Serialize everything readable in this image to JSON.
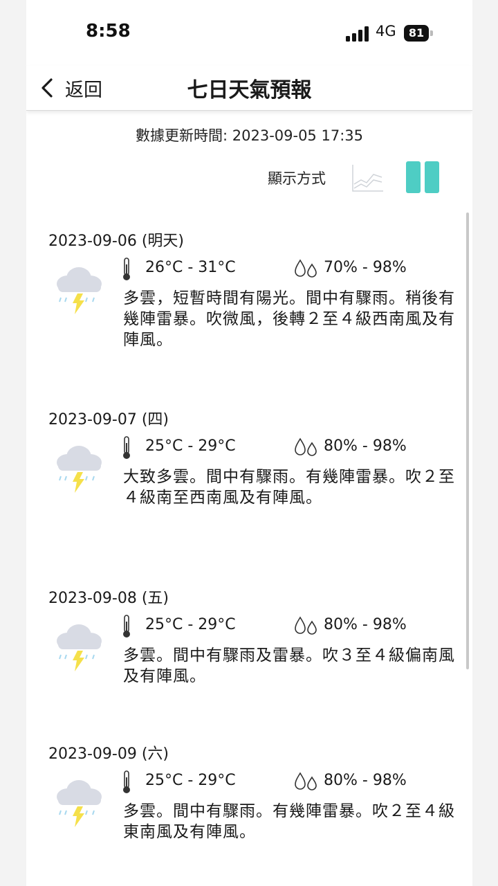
{
  "status": {
    "time": "8:58",
    "network": "4G",
    "battery": "81"
  },
  "nav": {
    "back_label": "返回",
    "title": "七日天氣預報"
  },
  "update_time": "數據更新時間: 2023-09-05 17:35",
  "display_mode": {
    "label": "顯示方式",
    "selected": "bar"
  },
  "colors": {
    "accent": "#4ecdc4",
    "cloud": "#d8dbe4",
    "rain": "#a8d8ef",
    "lightning": "#f5e04a"
  },
  "forecast": [
    {
      "date": "2023-09-06 (明天)",
      "icon": "cloud-thunder-rain-icon",
      "temp": "26°C - 31°C",
      "humidity": "70% - 98%",
      "desc": "多雲，短暫時間有陽光。間中有驟雨。稍後有幾陣雷暴。吹微風，後轉２至４級西南風及有陣風。"
    },
    {
      "date": "2023-09-07 (四)",
      "icon": "cloud-thunder-rain-icon",
      "temp": "25°C - 29°C",
      "humidity": "80% - 98%",
      "desc": "大致多雲。間中有驟雨。有幾陣雷暴。吹２至４級南至西南風及有陣風。"
    },
    {
      "date": "2023-09-08 (五)",
      "icon": "cloud-thunder-rain-icon",
      "temp": "25°C - 29°C",
      "humidity": "80% - 98%",
      "desc": "多雲。間中有驟雨及雷暴。吹３至４級偏南風及有陣風。"
    },
    {
      "date": "2023-09-09 (六)",
      "icon": "cloud-thunder-rain-icon",
      "temp": "25°C - 29°C",
      "humidity": "80% - 98%",
      "desc": "多雲。間中有驟雨。有幾陣雷暴。吹２至４級東南風及有陣風。"
    }
  ]
}
